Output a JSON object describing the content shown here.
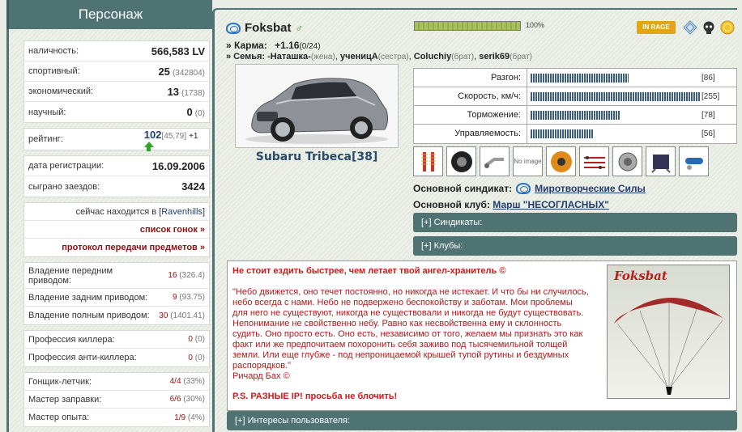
{
  "left": {
    "title": "Персонаж",
    "money": {
      "label": "наличность:",
      "value": "566,583 LV"
    },
    "sport": {
      "label": "спортивный:",
      "value": "25",
      "sub": "(342804)"
    },
    "econ": {
      "label": "экономический:",
      "value": "13",
      "sub": "(1738)"
    },
    "science": {
      "label": "научный:",
      "value": "0",
      "sub": "(0)"
    },
    "rating": {
      "label": "рейтинг:",
      "value": "102",
      "sub": "[45,79]",
      "delta": "+1"
    },
    "reg": {
      "label": "дата регистрации:",
      "value": "16.09.2006"
    },
    "races": {
      "label": "сыграно заездов:",
      "value": "3424"
    },
    "location_prefix": "сейчас находится в [",
    "location_name": "Ravenhills",
    "location_suffix": "]",
    "race_list": "список гонок »",
    "transfer_log": "протокол передачи предметов »",
    "skills_drive": [
      {
        "label": "Владение передним приводом:",
        "value": "16",
        "sub": "(326.4)"
      },
      {
        "label": "Владение задним приводом:",
        "value": "9",
        "sub": "(93.75)"
      },
      {
        "label": "Владение полным приводом:",
        "value": "30",
        "sub": "(1401.41)"
      }
    ],
    "skills_killer": [
      {
        "label": "Профессия киллера:",
        "value": "0",
        "sub": "(0)"
      },
      {
        "label": "Профессия анти-киллера:",
        "value": "0",
        "sub": "(0)"
      }
    ],
    "skills_pilot": [
      {
        "label": "Гонщик-летчик:",
        "value": "4/4",
        "sub": "(33%)"
      },
      {
        "label": "Мастер заправки:",
        "value": "6/6",
        "sub": "(30%)"
      },
      {
        "label": "Мастер опыта:",
        "value": "1/9",
        "sub": "(4%)"
      }
    ]
  },
  "main": {
    "nick": "Foksbat",
    "male_symbol": "♂",
    "karma_label": "» Карма:",
    "karma_value": "+1.16",
    "karma_sub": "(0/24)",
    "family_label": "» Семья:",
    "family": [
      {
        "name": "-Наташка-",
        "rel": "(жена)"
      },
      {
        "name": "ученицА",
        "rel": "(сестра)"
      },
      {
        "name": "Coluchiy",
        "rel": "(брат)"
      },
      {
        "name": "serik69",
        "rel": "(брат)"
      }
    ],
    "progress_pct": 100,
    "progress_label": "100%",
    "rage_label": "IN RAGE",
    "car_name": "Subaru Tribeca[38]",
    "stats": [
      {
        "label": "Разгон:",
        "value": "[86]",
        "fill": 0.34
      },
      {
        "label": "Скорость, км/ч:",
        "value": "[255]",
        "fill": 0.59
      },
      {
        "label": "Торможение:",
        "value": "[78]",
        "fill": 0.31
      },
      {
        "label": "Управляемость:",
        "value": "[56]",
        "fill": 0.22
      }
    ],
    "parts": [
      "shocks",
      "tire",
      "exhaust",
      "No image",
      "brake disc",
      "wiring",
      "turbo",
      "ecu",
      "nitro"
    ],
    "synd_label": "Основной синдикат:",
    "synd_name": "Миротворческие Силы",
    "club_label": "Основной клуб:",
    "club_name": "Марш \"НЕСОГЛАСНЫХ\"",
    "syndicates_section": "[+]  Синдикаты:",
    "clubs_section": "[+]  Клубы:",
    "quote_head": "Не стоит ездить быстрее, чем летает твой ангел-хранитель ©",
    "quote_text": "\"Небо движется, оно течет постоянно, но никогда не истекает. И что бы ни случилось, небо всегда с нами. Небо не подвержено беспокойству и заботам. Мои проблемы для него не существуют, никогда не существовали и никогда не будут существовать. Непонимание не свойственно небу. Равно как несвойственна ему и склонность судить. Оно просто есть. Оно есть, независимо от того, желаем мы признать это как факт или же предпочитаем похоронить себя заживо под тысячемильной толщей земли. Или еще глубже - под непроницаемой крышей тупой рутины и бездумных распорядков.\"",
    "quote_author": "Ричард Бах ©",
    "quote_ps": "P.S. РАЗНЫЕ IP! просьба не блочить!",
    "pic_name": "Foksbat",
    "interests_section": "[+]  Интересы пользователя:"
  }
}
